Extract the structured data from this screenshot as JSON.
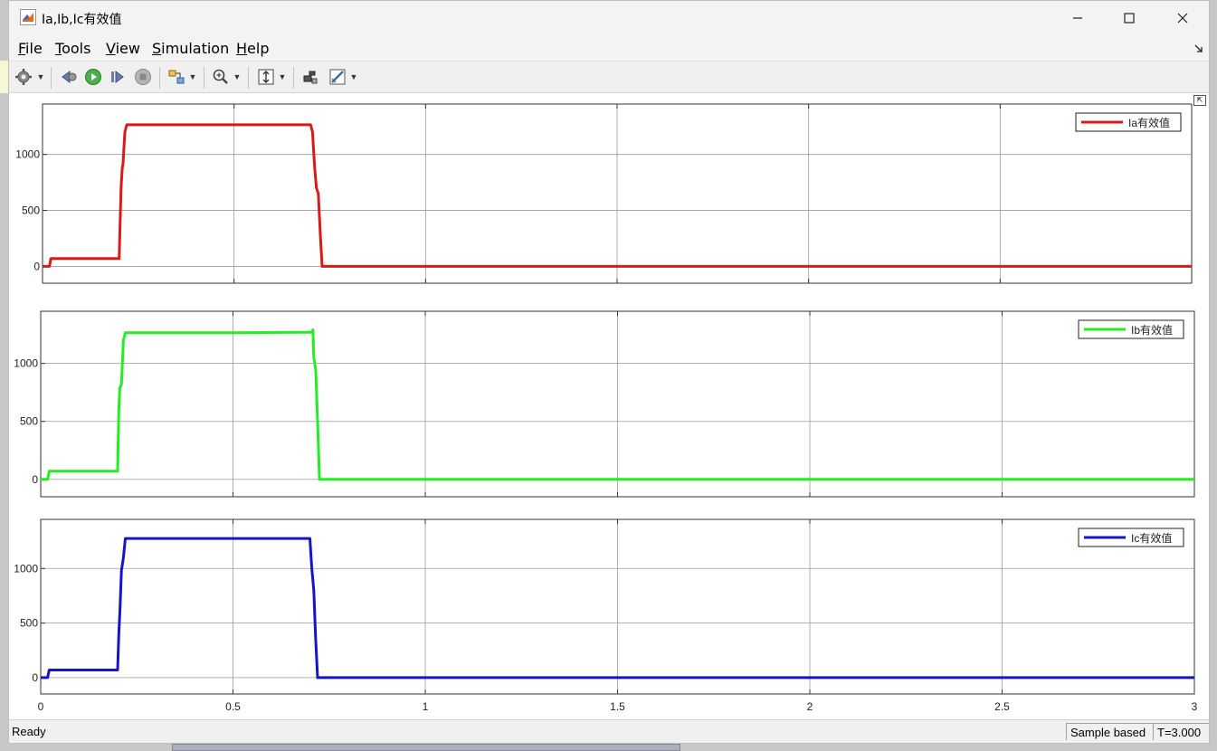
{
  "window": {
    "title": "Ia,Ib,Ic有效值",
    "minimize_glyph": "—",
    "maximize_glyph": "☐",
    "close_glyph": "✕"
  },
  "menu": [
    {
      "label": "File",
      "mnemonic": "F",
      "rest": "ile"
    },
    {
      "label": "Tools",
      "mnemonic": "T",
      "rest": "ools"
    },
    {
      "label": "View",
      "mnemonic": "V",
      "rest": "iew"
    },
    {
      "label": "Simulation",
      "mnemonic": "S",
      "rest": "imulation"
    },
    {
      "label": "Help",
      "mnemonic": "H",
      "rest": "elp"
    }
  ],
  "toolbar": {
    "icons": [
      "gear-icon",
      "step-back-icon",
      "run-icon",
      "step-forward-icon",
      "stop-icon",
      "highlight-block-icon",
      "zoom-icon",
      "autoscale-icon",
      "style-icon",
      "cursor-measure-icon"
    ]
  },
  "status": {
    "left": "Ready",
    "mode": "Sample based",
    "time": "T=3.000"
  },
  "chart_data": [
    {
      "type": "line",
      "xlim": [
        0,
        3
      ],
      "ylim": [
        -150,
        1450
      ],
      "yticks": [
        "0",
        "500",
        "1000"
      ],
      "xticks": [
        "0",
        "0.5",
        "1",
        "1.5",
        "2",
        "2.5",
        "3"
      ],
      "grid": true,
      "legend_placement": "top-right",
      "series": [
        {
          "name": "Ia有效值",
          "color": "#d91a1a",
          "x": [
            0,
            0.018,
            0.022,
            0.2,
            0.205,
            0.208,
            0.21,
            0.215,
            0.22,
            0.5,
            0.7,
            0.705,
            0.71,
            0.715,
            0.72,
            0.725,
            0.73,
            3
          ],
          "y": [
            0,
            0,
            70,
            70,
            700,
            880,
            910,
            1200,
            1265,
            1265,
            1265,
            1200,
            900,
            700,
            650,
            300,
            0,
            0
          ]
        }
      ]
    },
    {
      "type": "line",
      "xlim": [
        0,
        3
      ],
      "ylim": [
        -150,
        1450
      ],
      "yticks": [
        "0",
        "500",
        "1000"
      ],
      "xticks": [
        "0",
        "0.5",
        "1",
        "1.5",
        "2",
        "2.5",
        "3"
      ],
      "grid": true,
      "legend_placement": "top-right",
      "series": [
        {
          "name": "Ib有效值",
          "color": "#22ee22",
          "x": [
            0,
            0.018,
            0.022,
            0.2,
            0.203,
            0.206,
            0.21,
            0.215,
            0.22,
            0.5,
            0.705,
            0.708,
            0.71,
            0.715,
            0.72,
            0.725,
            3
          ],
          "y": [
            0,
            0,
            70,
            70,
            600,
            790,
            820,
            1200,
            1265,
            1265,
            1270,
            1290,
            1050,
            950,
            500,
            0,
            0
          ]
        }
      ]
    },
    {
      "type": "line",
      "xlim": [
        0,
        3
      ],
      "ylim": [
        -150,
        1450
      ],
      "yticks": [
        "0",
        "500",
        "1000"
      ],
      "xticks": [
        "0",
        "0.5",
        "1",
        "1.5",
        "2",
        "2.5",
        "3"
      ],
      "xlabels_shown": true,
      "grid": true,
      "legend_placement": "top-right",
      "series": [
        {
          "name": "Ic有效值",
          "color": "#1515c8",
          "x": [
            0,
            0.018,
            0.022,
            0.2,
            0.203,
            0.206,
            0.21,
            0.215,
            0.22,
            0.5,
            0.7,
            0.705,
            0.71,
            0.715,
            0.72,
            3
          ],
          "y": [
            0,
            0,
            70,
            70,
            400,
            600,
            980,
            1100,
            1275,
            1275,
            1275,
            1000,
            800,
            350,
            0,
            0
          ]
        }
      ]
    }
  ]
}
